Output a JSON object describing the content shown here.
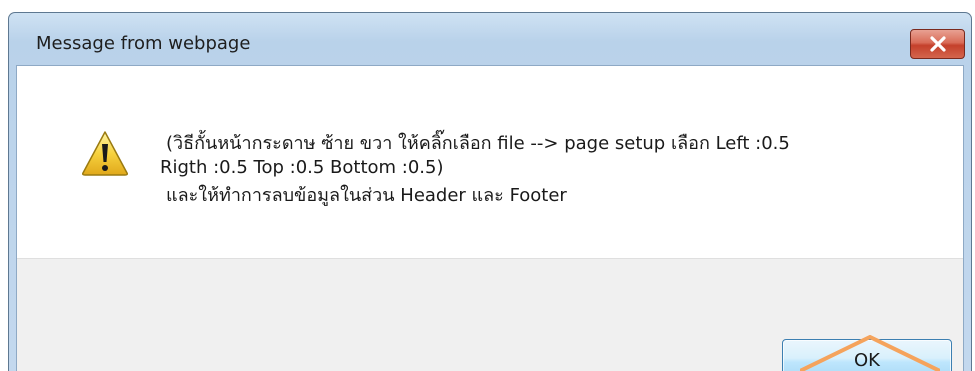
{
  "dialog": {
    "title": "Message from webpage",
    "close_icon": "close-x-icon",
    "message_icon": "warning-icon",
    "message": {
      "line1": "(วิธีกั้นหน้ากระดาษ ซ้าย ขวา ให้คลิ๊กเลือก file --> page setup เลือก Left :0.5",
      "line2": "Rigth :0.5 Top :0.5 Bottom :0.5)",
      "line3": "และให้ทำการลบข้อมูลในส่วน Header และ Footer"
    },
    "ok_label": "OK"
  },
  "colors": {
    "titlebar": "#c3d8ee",
    "close_button": "#c4402b",
    "ok_button_border": "#3c7fb1",
    "button_area": "#f0f0f0",
    "callout_arrow": "#f5a35c",
    "warning_yellow": "#f7d23e"
  }
}
